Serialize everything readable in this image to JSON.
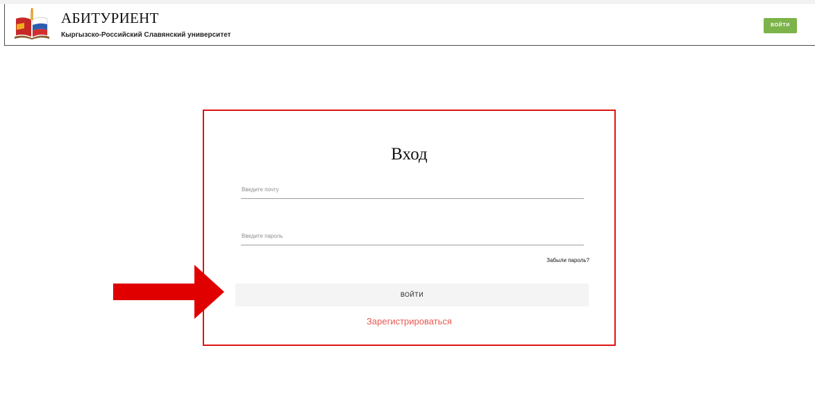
{
  "header": {
    "title": "АБИТУРИЕНТ",
    "subtitle": "Кыргызско-Российский Славянский университет",
    "login_label": "ВОЙТИ"
  },
  "login_form": {
    "title": "Вход",
    "email_placeholder": "Введите почту",
    "password_placeholder": "Введите пароль",
    "forgot_label": "Забыли пароль?",
    "submit_label": "ВОЙТИ",
    "register_label": "Зарегистрироваться"
  },
  "colors": {
    "accent_green": "#7cb34a",
    "highlight_red": "#e01111",
    "register_link": "#e9574f"
  },
  "icons": {
    "logo": "university-logo-icon",
    "annotation": "red-arrow-icon"
  }
}
